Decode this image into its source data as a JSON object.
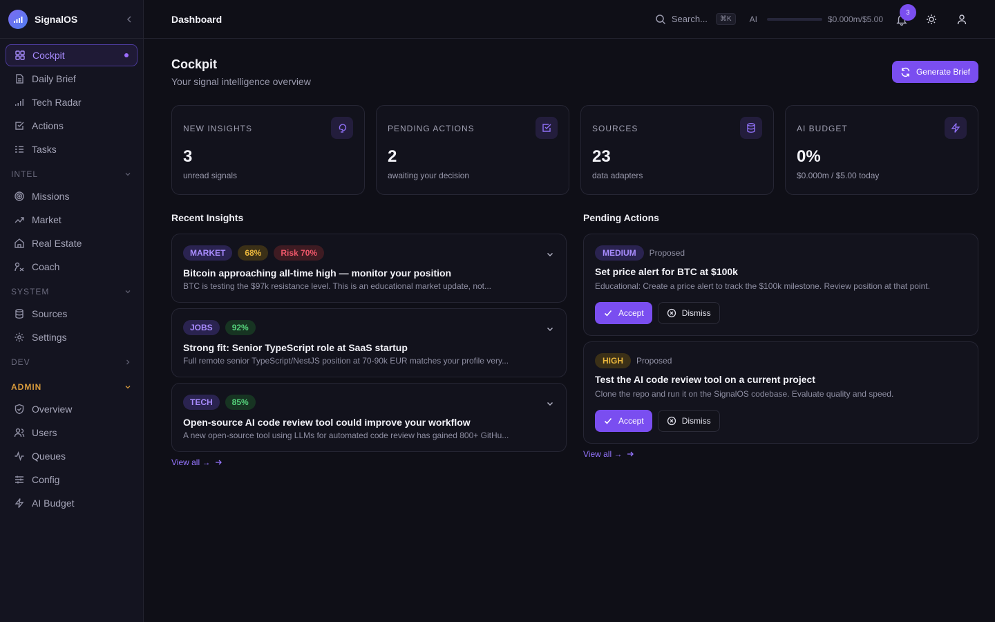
{
  "app": {
    "name": "SignalOS"
  },
  "sidebar": {
    "primary": [
      {
        "label": "Cockpit",
        "icon": "grid-icon"
      },
      {
        "label": "Daily Brief",
        "icon": "document-icon"
      },
      {
        "label": "Tech Radar",
        "icon": "signal-bars-icon"
      },
      {
        "label": "Actions",
        "icon": "checkbox-icon"
      },
      {
        "label": "Tasks",
        "icon": "list-checks-icon"
      }
    ],
    "sections": {
      "intel": {
        "label": "INTEL",
        "items": [
          {
            "label": "Missions",
            "icon": "target-icon"
          },
          {
            "label": "Market",
            "icon": "trending-up-icon"
          },
          {
            "label": "Real Estate",
            "icon": "home-icon"
          },
          {
            "label": "Coach",
            "icon": "coach-icon"
          }
        ]
      },
      "system": {
        "label": "SYSTEM",
        "items": [
          {
            "label": "Sources",
            "icon": "database-icon"
          },
          {
            "label": "Settings",
            "icon": "gear-icon"
          }
        ]
      },
      "dev": {
        "label": "DEV"
      },
      "admin": {
        "label": "ADMIN",
        "items": [
          {
            "label": "Overview",
            "icon": "shield-icon"
          },
          {
            "label": "Users",
            "icon": "users-icon"
          },
          {
            "label": "Queues",
            "icon": "activity-icon"
          },
          {
            "label": "Config",
            "icon": "sliders-icon"
          },
          {
            "label": "AI Budget",
            "icon": "bolt-icon"
          }
        ]
      }
    }
  },
  "topbar": {
    "title": "Dashboard",
    "search_placeholder": "Search...",
    "shortcut": "⌘K",
    "ai_label": "AI",
    "ai_cost": "$0.000m/$5.00",
    "notification_count": "3"
  },
  "page": {
    "title": "Cockpit",
    "subtitle": "Your signal intelligence overview",
    "generate_label": "Generate Brief"
  },
  "stats": [
    {
      "label": "NEW INSIGHTS",
      "value": "3",
      "desc": "unread signals",
      "icon": "lightbulb-icon"
    },
    {
      "label": "PENDING ACTIONS",
      "value": "2",
      "desc": "awaiting your decision",
      "icon": "checkbox-icon"
    },
    {
      "label": "SOURCES",
      "value": "23",
      "desc": "data adapters",
      "icon": "database-icon"
    },
    {
      "label": "AI BUDGET",
      "value": "0%",
      "desc": "$0.000m / $5.00 today",
      "icon": "bolt-icon"
    }
  ],
  "insights": {
    "title": "Recent Insights",
    "view_all": "View all →",
    "items": [
      {
        "tags": [
          "MARKET",
          "68%",
          "Risk 70%"
        ],
        "title": "Bitcoin approaching all-time high — monitor your position",
        "body": "BTC is testing the $97k resistance level. This is an educational market update, not..."
      },
      {
        "tags": [
          "JOBS",
          "92%"
        ],
        "title": "Strong fit: Senior TypeScript role at SaaS startup",
        "body": "Full remote senior TypeScript/NestJS position at 70-90k EUR matches your profile very..."
      },
      {
        "tags": [
          "TECH",
          "85%"
        ],
        "title": "Open-source AI code review tool could improve your workflow",
        "body": "A new open-source tool using LLMs for automated code review has gained 800+ GitHu..."
      }
    ]
  },
  "actions": {
    "title": "Pending Actions",
    "view_all": "View all →",
    "accept_label": "Accept",
    "dismiss_label": "Dismiss",
    "items": [
      {
        "priority": "MEDIUM",
        "status": "Proposed",
        "title": "Set price alert for BTC at $100k",
        "body": "Educational: Create a price alert to track the $100k milestone. Review position at that point."
      },
      {
        "priority": "HIGH",
        "status": "Proposed",
        "title": "Test the AI code review tool on a current project",
        "body": "Clone the repo and run it on the SignalOS codebase. Evaluate quality and speed."
      }
    ]
  },
  "colors": {
    "accent": "#7a4ef0",
    "background": "#0f0f17",
    "admin_section": "#d79a3c"
  }
}
